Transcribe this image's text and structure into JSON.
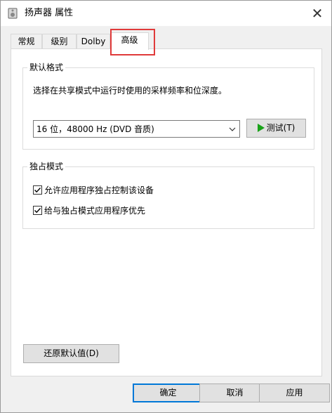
{
  "window": {
    "title": "扬声器 属性",
    "icon": "speaker-icon"
  },
  "tabs": [
    {
      "label": "常规",
      "active": false
    },
    {
      "label": "级别",
      "active": false
    },
    {
      "label": "Dolby",
      "active": false
    },
    {
      "label": "高级",
      "active": true
    }
  ],
  "default_format": {
    "group_title": "默认格式",
    "description": "选择在共享模式中运行时使用的采样频率和位深度。",
    "selected": "16 位，48000 Hz (DVD 音质)",
    "test_label": "测试(T)"
  },
  "exclusive_mode": {
    "group_title": "独占模式",
    "options": [
      {
        "label": "允许应用程序独占控制该设备",
        "checked": true
      },
      {
        "label": "给与独占模式应用程序优先",
        "checked": true
      }
    ]
  },
  "restore_label": "还原默认值(D)",
  "footer": {
    "ok_label": "确定",
    "cancel_label": "取消",
    "apply_label": "应用"
  },
  "colors": {
    "accent": "#0078d7",
    "highlight_box": "#e03a3a",
    "play": "#1aa31a"
  }
}
